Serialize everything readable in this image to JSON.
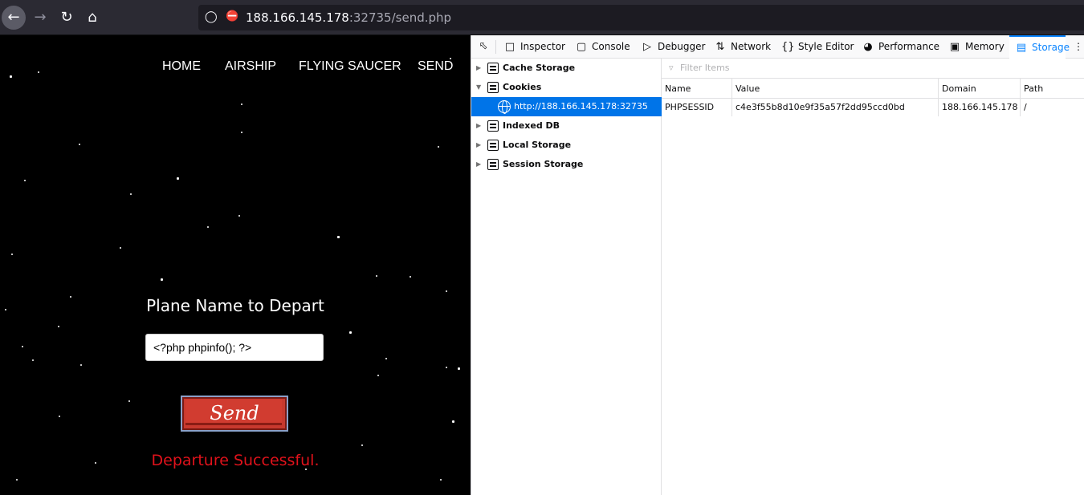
{
  "browser": {
    "url_host": "188.166.145.178",
    "url_rest": ":32735/send.php",
    "back_icon": "arrow-left",
    "forward_icon": "arrow-right",
    "reload_icon": "reload",
    "home_icon": "home"
  },
  "site": {
    "nav": [
      "HOME",
      "AIRSHIP",
      "FLYING SAUCER",
      "SEND"
    ],
    "form_title": "Plane Name to Depart",
    "input_value": "<?php phpinfo(); ?>",
    "send_label": "Send",
    "status": "Departure Successful.",
    "status_color": "#e0121b",
    "button_color": "#d13c30"
  },
  "devtools": {
    "tabs": [
      "Inspector",
      "Console",
      "Debugger",
      "Network",
      "Style Editor",
      "Performance",
      "Memory",
      "Storage"
    ],
    "active_tab": "Storage",
    "tree": {
      "cache_storage": "Cache Storage",
      "cookies": "Cookies",
      "cookie_host": "http://188.166.145.178:32735",
      "indexed_db": "Indexed DB",
      "local_storage": "Local Storage",
      "session_storage": "Session Storage"
    },
    "filter_placeholder": "Filter Items",
    "columns": [
      "Name",
      "Value",
      "Domain",
      "Path"
    ],
    "rows": [
      {
        "name": "PHPSESSID",
        "value": "c4e3f55b8d10e9f35a57f2dd95ccd0bd",
        "domain": "188.166.145.178",
        "path": "/"
      }
    ]
  }
}
